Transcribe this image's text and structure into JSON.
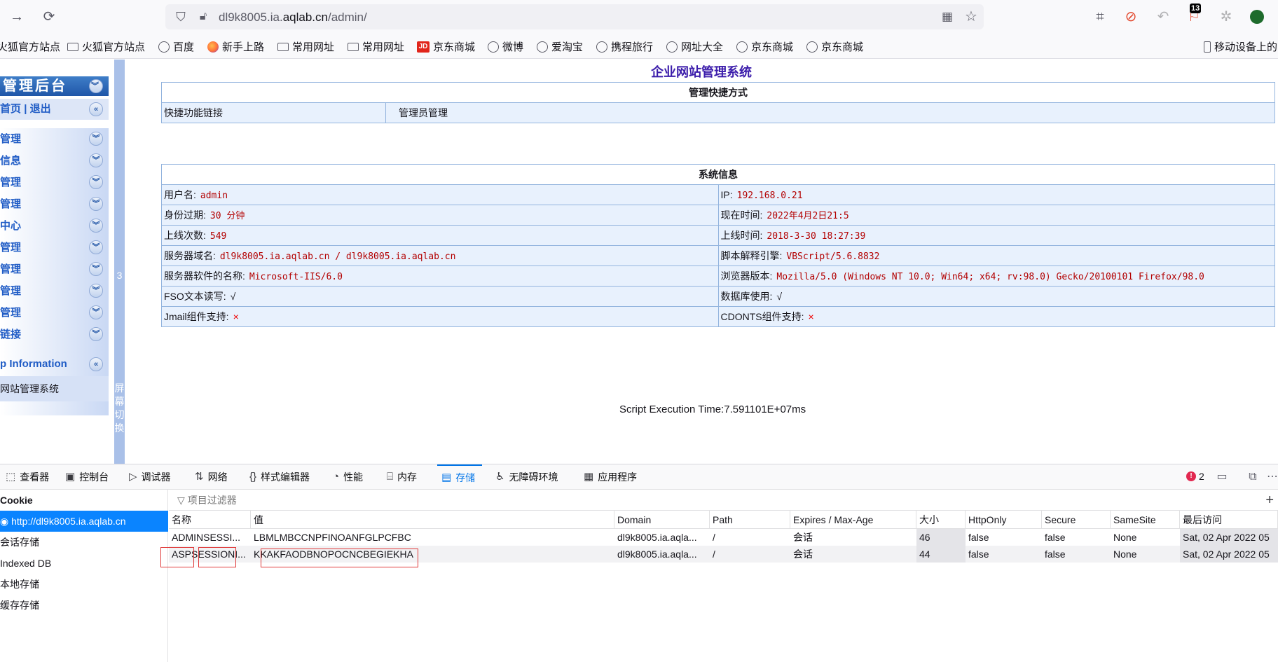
{
  "toolbar": {
    "url_host_prefix": "dl9k8005.ia.",
    "url_host_main": "aqlab.cn",
    "url_path": "/admin/",
    "badge_count": "13"
  },
  "bookmarks": [
    {
      "label": "火狐官方站点",
      "icon": "folder-icon"
    },
    {
      "label": "火狐官方站点",
      "icon": "folder-icon"
    },
    {
      "label": "百度",
      "icon": "globe-icon"
    },
    {
      "label": "新手上路",
      "icon": "firefox-icon"
    },
    {
      "label": "常用网址",
      "icon": "folder-icon"
    },
    {
      "label": "常用网址",
      "icon": "folder-icon"
    },
    {
      "label": "京东商城",
      "icon": "jd-icon"
    },
    {
      "label": "微博",
      "icon": "globe-icon"
    },
    {
      "label": "爱淘宝",
      "icon": "globe-icon"
    },
    {
      "label": "携程旅行",
      "icon": "globe-icon"
    },
    {
      "label": "网址大全",
      "icon": "globe-icon"
    },
    {
      "label": "京东商城",
      "icon": "globe-icon"
    },
    {
      "label": "京东商城",
      "icon": "globe-icon"
    }
  ],
  "bookmarks_right": "移动设备上的",
  "sidebar": {
    "header": "管理后台",
    "home_link": "首页",
    "separator": "|",
    "logout_link": "退出",
    "menu": [
      "管理",
      "信息",
      "管理",
      "管理",
      "中心",
      "管理",
      "管理",
      "管理",
      "管理",
      "链接"
    ],
    "info_header": "p Information",
    "system_name": "网站管理系统"
  },
  "splitter": {
    "number": "3",
    "label": [
      "屏",
      "幕",
      "切",
      "换"
    ]
  },
  "main": {
    "title": "企业网站管理系统",
    "shortcuts": {
      "header": "管理快捷方式",
      "label": "快捷功能链接",
      "link": "管理员管理"
    },
    "sysinfo": {
      "header": "系统信息",
      "rows": [
        {
          "l_label": "用户名:",
          "l_value": "admin",
          "r_label": "IP:",
          "r_value": "192.168.0.21"
        },
        {
          "l_label": "身份过期:",
          "l_value": "30 分钟",
          "r_label": "现在时间:",
          "r_value": "2022年4月2日21:5"
        },
        {
          "l_label": "上线次数:",
          "l_value": "549",
          "r_label": "上线时间:",
          "r_value": "2018-3-30 18:27:39"
        },
        {
          "l_label": "服务器域名:",
          "l_value": "dl9k8005.ia.aqlab.cn / dl9k8005.ia.aqlab.cn",
          "r_label": "脚本解释引擎:",
          "r_value": "VBScript/5.6.8832"
        },
        {
          "l_label": "服务器软件的名称:",
          "l_value": "Microsoft-IIS/6.0",
          "r_label": "浏览器版本:",
          "r_value": "Mozilla/5.0 (Windows NT 10.0; Win64; x64; rv:98.0) Gecko/20100101 Firefox/98.0"
        },
        {
          "l_label": "FSO文本读写:",
          "l_value": "√",
          "r_label": "数据库使用:",
          "r_value": "√"
        },
        {
          "l_label": "Jmail组件支持:",
          "l_value": "×",
          "r_label": "CDONTS组件支持:",
          "r_value": "×"
        }
      ]
    },
    "exec_time": "Script Execution Time:7.591101E+07ms"
  },
  "devtools": {
    "tabs": [
      {
        "label": "查看器",
        "icon": "inspector-icon"
      },
      {
        "label": "控制台",
        "icon": "console-icon"
      },
      {
        "label": "调试器",
        "icon": "debugger-icon"
      },
      {
        "label": "网络",
        "icon": "network-icon"
      },
      {
        "label": "样式编辑器",
        "icon": "style-editor-icon"
      },
      {
        "label": "性能",
        "icon": "performance-icon"
      },
      {
        "label": "内存",
        "icon": "memory-icon"
      },
      {
        "label": "存储",
        "icon": "storage-icon"
      },
      {
        "label": "无障碍环境",
        "icon": "accessibility-icon"
      },
      {
        "label": "应用程序",
        "icon": "application-icon"
      }
    ],
    "active_tab": "存储",
    "error_count": "2",
    "tree": [
      "Cookie",
      "http://dl9k8005.ia.aqlab.cn",
      "会话存储",
      "Indexed DB",
      "本地存储",
      "缓存存储"
    ],
    "filter_placeholder": "项目过滤器",
    "columns": [
      "名称",
      "值",
      "Domain",
      "Path",
      "Expires / Max-Age",
      "大小",
      "HttpOnly",
      "Secure",
      "SameSite",
      "最后访问"
    ],
    "rows": [
      [
        "ADMINSESSI...",
        "LBMLMBCCNPFINOANFGLPCFBC",
        "dl9k8005.ia.aqla...",
        "/",
        "会话",
        "46",
        "false",
        "false",
        "None",
        "Sat, 02 Apr 2022 05"
      ],
      [
        "ASPSESSIONI...",
        "KKAKFAODBNOPOCNCBEGIEKHA",
        "dl9k8005.ia.aqla...",
        "/",
        "会话",
        "44",
        "false",
        "false",
        "None",
        "Sat, 02 Apr 2022 05"
      ]
    ]
  }
}
